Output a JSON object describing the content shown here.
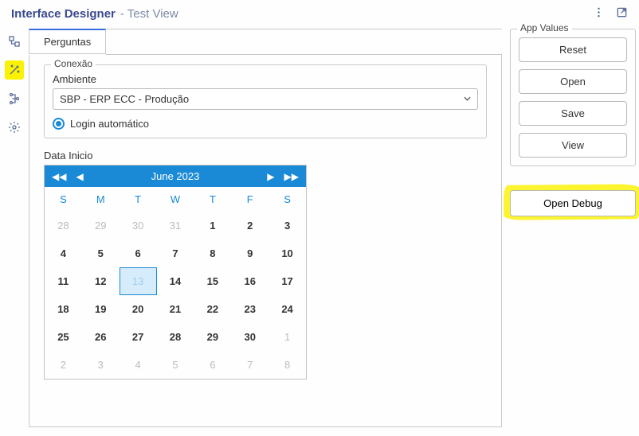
{
  "titlebar": {
    "main": "Interface Designer",
    "sub": "- Test View"
  },
  "tab": {
    "label": "Perguntas"
  },
  "connection": {
    "legend": "Conexão",
    "env_label": "Ambiente",
    "env_value": "SBP - ERP ECC - Produção",
    "login_auto": "Login automático"
  },
  "date": {
    "label": "Data Inicio",
    "month_title": "June 2023",
    "dow": [
      "S",
      "M",
      "T",
      "W",
      "T",
      "F",
      "S"
    ],
    "cells": [
      {
        "n": 28,
        "o": true
      },
      {
        "n": 29,
        "o": true
      },
      {
        "n": 30,
        "o": true
      },
      {
        "n": 31,
        "o": true
      },
      {
        "n": 1
      },
      {
        "n": 2
      },
      {
        "n": 3
      },
      {
        "n": 4
      },
      {
        "n": 5
      },
      {
        "n": 6
      },
      {
        "n": 7
      },
      {
        "n": 8
      },
      {
        "n": 9
      },
      {
        "n": 10
      },
      {
        "n": 11
      },
      {
        "n": 12
      },
      {
        "n": 13,
        "sel": true
      },
      {
        "n": 14
      },
      {
        "n": 15
      },
      {
        "n": 16
      },
      {
        "n": 17
      },
      {
        "n": 18
      },
      {
        "n": 19
      },
      {
        "n": 20
      },
      {
        "n": 21
      },
      {
        "n": 22
      },
      {
        "n": 23
      },
      {
        "n": 24
      },
      {
        "n": 25
      },
      {
        "n": 26
      },
      {
        "n": 27
      },
      {
        "n": 28
      },
      {
        "n": 29
      },
      {
        "n": 30
      },
      {
        "n": 1,
        "o": true
      },
      {
        "n": 2,
        "o": true
      },
      {
        "n": 3,
        "o": true
      },
      {
        "n": 4,
        "o": true
      },
      {
        "n": 5,
        "o": true
      },
      {
        "n": 6,
        "o": true
      },
      {
        "n": 7,
        "o": true
      },
      {
        "n": 8,
        "o": true
      }
    ]
  },
  "app_values": {
    "legend": "App Values",
    "reset": "Reset",
    "open": "Open",
    "save": "Save",
    "view": "View"
  },
  "open_debug": "Open Debug"
}
